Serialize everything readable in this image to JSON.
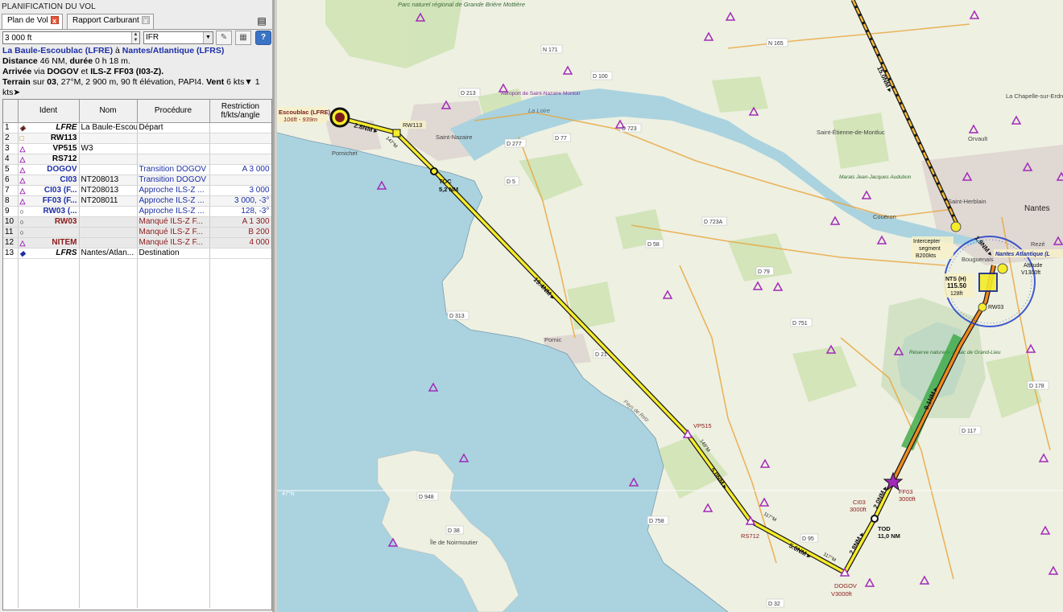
{
  "panel": {
    "title": "PLANIFICATION DU VOL",
    "tabs": [
      {
        "label": "Plan de Vol",
        "close": "x"
      },
      {
        "label": "Rapport Carburant",
        "close": "x"
      }
    ],
    "menu_icon": "menu-icon",
    "altitude": "3 000 ft",
    "flight_rules": "IFR",
    "help_label": "?"
  },
  "summary": {
    "from": "La Baule-Escoublac (LFRE)",
    "to_word": "à",
    "to": "Nantes/Atlantique (LFRS)",
    "distance_label": "Distance",
    "distance": "46 NM",
    "duration_label": "durée",
    "duration": "0 h 18 m.",
    "arrival_label": "Arrivée",
    "arrival_via": "via",
    "arrival_fix": "DOGOV",
    "arrival_and": "et",
    "arrival_proc": "ILS-Z FF03 (I03-Z).",
    "runway_label": "Terrain",
    "runway_text_pre": "sur",
    "runway": "03",
    "runway_details": ", 27°M, 2 900 m, 90 ft élévation, PAPI4.",
    "wind_label": "Vent",
    "wind": "6 kts",
    "wind_tail": "1 kts",
    "wind_arrow": "▼",
    "wind_arrow2": "➤"
  },
  "table": {
    "headers": [
      "Ident",
      "Nom",
      "Procédure",
      "Restriction ft/kts/angle"
    ],
    "rows": [
      {
        "n": "1",
        "ident": "LFRE",
        "nom": "La Baule-Escoubl...",
        "proc": "Départ",
        "restr": ""
      },
      {
        "n": "2",
        "ident": "RW113",
        "nom": "",
        "proc": "",
        "restr": ""
      },
      {
        "n": "3",
        "ident": "VP515",
        "nom": "W3",
        "proc": "",
        "restr": ""
      },
      {
        "n": "4",
        "ident": "RS712",
        "nom": "",
        "proc": "",
        "restr": ""
      },
      {
        "n": "5",
        "ident": "DOGOV",
        "nom": "",
        "proc": "Transition DOGOV",
        "restr": "A 3 000"
      },
      {
        "n": "6",
        "ident": "CI03",
        "nom": "NT208013",
        "proc": "Transition DOGOV",
        "restr": ""
      },
      {
        "n": "7",
        "ident": "CI03 (F...",
        "nom": "NT208013",
        "proc": "Approche ILS-Z ...",
        "restr": "3 000"
      },
      {
        "n": "8",
        "ident": "FF03 (F...",
        "nom": "NT208011",
        "proc": "Approche ILS-Z ...",
        "restr": "3 000, -3°"
      },
      {
        "n": "9",
        "ident": "RW03 (...",
        "nom": "",
        "proc": "Approche ILS-Z ...",
        "restr": "128, -3°"
      },
      {
        "n": "10",
        "ident": "RW03",
        "nom": "",
        "proc": "Manqué ILS-Z F...",
        "restr": "A 1 300"
      },
      {
        "n": "11",
        "ident": "",
        "nom": "",
        "proc": "Manqué ILS-Z F...",
        "restr": "B 200"
      },
      {
        "n": "12",
        "ident": "NITEM",
        "nom": "",
        "proc": "Manqué ILS-Z F...",
        "restr": "4 000"
      },
      {
        "n": "13",
        "ident": "LFRS",
        "nom": "Nantes/Atlan...",
        "proc": "Destination",
        "restr": ""
      }
    ]
  },
  "map": {
    "colors": {
      "route_yellow": "#f5ec2a",
      "route_border": "#1a1a1a",
      "water": "#aad3df",
      "land": "#f2efe9",
      "waypoint": "#a22bb8",
      "approach": "#f08a1e",
      "ils": "#2fae3d",
      "compass": "#2040c8"
    },
    "place_labels": [
      "Parc naturel régional de Grande Brière Mottière",
      "Saint-Nazaire",
      "Aéroport de Saint-Nazaire Montoir",
      "Pornichet",
      "Saint-Étienne-de-Montluc",
      "Couëron",
      "Saint-Herblain",
      "Nantes",
      "Orvault",
      "La Chapelle-sur-Erdre",
      "Rezé",
      "Bouguenais",
      "Pornic",
      "L'Île de Noirmoutier",
      "La Loire",
      "Marais Jean-Jacques Audubon",
      "Réserve naturelle du lac de Grand-Lieu",
      "Pays de Retz"
    ],
    "road_labels": [
      "D 100",
      "D 213",
      "N 171",
      "N 165",
      "D 277",
      "D 77",
      "D 723",
      "D 5",
      "D 723A",
      "D 58",
      "D 79",
      "D 751",
      "D 313",
      "D 21",
      "D 948",
      "D 38",
      "D 758",
      "D 95",
      "D 117",
      "D 178",
      "D 32"
    ],
    "departure_label": "Escoublac (LFRE)",
    "departure_info": "106ft - 939m",
    "rw113": "RW113",
    "toc": "TOC",
    "toc_dist": "5,2 NM",
    "leg1": "2.8NM ▸",
    "leg2": "19.4NM ▸",
    "leg3": "5.0NM ▸",
    "leg4": "5.0NM ▸",
    "leg5": "2.8NM ▸",
    "leg6": "2.0NM ▸",
    "leg7": "9.1NM ▸",
    "leg_top": "15.0NM ▸",
    "leg_near": "1.9NM ▸",
    "vp515": "VP515",
    "rs712": "RS712",
    "dogov": "DOGOV",
    "dogov_alt": "V3000ft",
    "ci03": "CI03",
    "ci03_alt": "3000ft",
    "ff03": "FF03",
    "ff03_alt": "3000ft",
    "tod": "TOD",
    "tod_dist": "11,0 NM",
    "intercept": "Intercepter segment",
    "intercept_spd": "B200kts",
    "nts": "NTS (H)",
    "nts_freq": "115.50",
    "nts_alt": "128ft",
    "rw03": "RW03",
    "nantes_label": "Nantes Atlantique (L",
    "alt_label": "Altitude",
    "alt_value": "V1300ft",
    "lat_label": "47°N",
    "course_117a": "117°M",
    "course_117b": "117°M",
    "course_147": "147°M",
    "course_149": "149°M"
  }
}
